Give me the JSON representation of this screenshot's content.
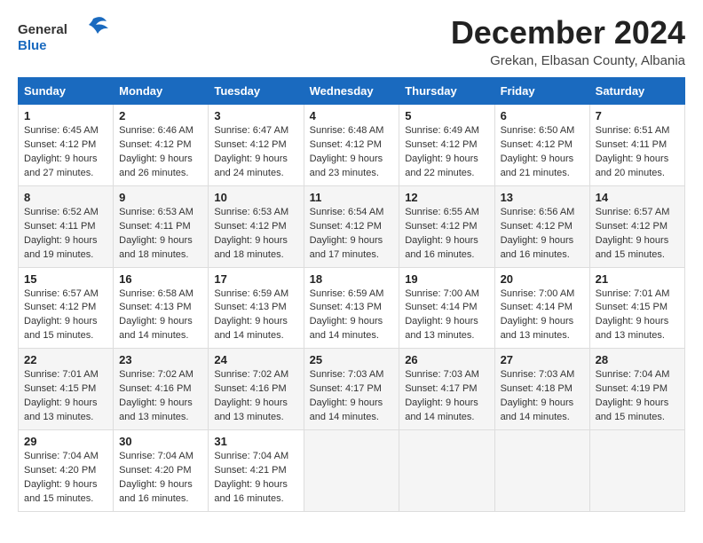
{
  "header": {
    "logo_general": "General",
    "logo_blue": "Blue",
    "month_title": "December 2024",
    "location": "Grekan, Elbasan County, Albania"
  },
  "columns": [
    "Sunday",
    "Monday",
    "Tuesday",
    "Wednesday",
    "Thursday",
    "Friday",
    "Saturday"
  ],
  "weeks": [
    [
      {
        "day": "1",
        "sunrise": "6:45 AM",
        "sunset": "4:12 PM",
        "daylight": "9 hours and 27 minutes."
      },
      {
        "day": "2",
        "sunrise": "6:46 AM",
        "sunset": "4:12 PM",
        "daylight": "9 hours and 26 minutes."
      },
      {
        "day": "3",
        "sunrise": "6:47 AM",
        "sunset": "4:12 PM",
        "daylight": "9 hours and 24 minutes."
      },
      {
        "day": "4",
        "sunrise": "6:48 AM",
        "sunset": "4:12 PM",
        "daylight": "9 hours and 23 minutes."
      },
      {
        "day": "5",
        "sunrise": "6:49 AM",
        "sunset": "4:12 PM",
        "daylight": "9 hours and 22 minutes."
      },
      {
        "day": "6",
        "sunrise": "6:50 AM",
        "sunset": "4:12 PM",
        "daylight": "9 hours and 21 minutes."
      },
      {
        "day": "7",
        "sunrise": "6:51 AM",
        "sunset": "4:11 PM",
        "daylight": "9 hours and 20 minutes."
      }
    ],
    [
      {
        "day": "8",
        "sunrise": "6:52 AM",
        "sunset": "4:11 PM",
        "daylight": "9 hours and 19 minutes."
      },
      {
        "day": "9",
        "sunrise": "6:53 AM",
        "sunset": "4:11 PM",
        "daylight": "9 hours and 18 minutes."
      },
      {
        "day": "10",
        "sunrise": "6:53 AM",
        "sunset": "4:12 PM",
        "daylight": "9 hours and 18 minutes."
      },
      {
        "day": "11",
        "sunrise": "6:54 AM",
        "sunset": "4:12 PM",
        "daylight": "9 hours and 17 minutes."
      },
      {
        "day": "12",
        "sunrise": "6:55 AM",
        "sunset": "4:12 PM",
        "daylight": "9 hours and 16 minutes."
      },
      {
        "day": "13",
        "sunrise": "6:56 AM",
        "sunset": "4:12 PM",
        "daylight": "9 hours and 16 minutes."
      },
      {
        "day": "14",
        "sunrise": "6:57 AM",
        "sunset": "4:12 PM",
        "daylight": "9 hours and 15 minutes."
      }
    ],
    [
      {
        "day": "15",
        "sunrise": "6:57 AM",
        "sunset": "4:12 PM",
        "daylight": "9 hours and 15 minutes."
      },
      {
        "day": "16",
        "sunrise": "6:58 AM",
        "sunset": "4:13 PM",
        "daylight": "9 hours and 14 minutes."
      },
      {
        "day": "17",
        "sunrise": "6:59 AM",
        "sunset": "4:13 PM",
        "daylight": "9 hours and 14 minutes."
      },
      {
        "day": "18",
        "sunrise": "6:59 AM",
        "sunset": "4:13 PM",
        "daylight": "9 hours and 14 minutes."
      },
      {
        "day": "19",
        "sunrise": "7:00 AM",
        "sunset": "4:14 PM",
        "daylight": "9 hours and 13 minutes."
      },
      {
        "day": "20",
        "sunrise": "7:00 AM",
        "sunset": "4:14 PM",
        "daylight": "9 hours and 13 minutes."
      },
      {
        "day": "21",
        "sunrise": "7:01 AM",
        "sunset": "4:15 PM",
        "daylight": "9 hours and 13 minutes."
      }
    ],
    [
      {
        "day": "22",
        "sunrise": "7:01 AM",
        "sunset": "4:15 PM",
        "daylight": "9 hours and 13 minutes."
      },
      {
        "day": "23",
        "sunrise": "7:02 AM",
        "sunset": "4:16 PM",
        "daylight": "9 hours and 13 minutes."
      },
      {
        "day": "24",
        "sunrise": "7:02 AM",
        "sunset": "4:16 PM",
        "daylight": "9 hours and 13 minutes."
      },
      {
        "day": "25",
        "sunrise": "7:03 AM",
        "sunset": "4:17 PM",
        "daylight": "9 hours and 14 minutes."
      },
      {
        "day": "26",
        "sunrise": "7:03 AM",
        "sunset": "4:17 PM",
        "daylight": "9 hours and 14 minutes."
      },
      {
        "day": "27",
        "sunrise": "7:03 AM",
        "sunset": "4:18 PM",
        "daylight": "9 hours and 14 minutes."
      },
      {
        "day": "28",
        "sunrise": "7:04 AM",
        "sunset": "4:19 PM",
        "daylight": "9 hours and 15 minutes."
      }
    ],
    [
      {
        "day": "29",
        "sunrise": "7:04 AM",
        "sunset": "4:20 PM",
        "daylight": "9 hours and 15 minutes."
      },
      {
        "day": "30",
        "sunrise": "7:04 AM",
        "sunset": "4:20 PM",
        "daylight": "9 hours and 16 minutes."
      },
      {
        "day": "31",
        "sunrise": "7:04 AM",
        "sunset": "4:21 PM",
        "daylight": "9 hours and 16 minutes."
      },
      null,
      null,
      null,
      null
    ]
  ],
  "labels": {
    "sunrise": "Sunrise:",
    "sunset": "Sunset:",
    "daylight": "Daylight:"
  },
  "colors": {
    "header_bg": "#1a6abf",
    "accent": "#1a6abf"
  }
}
